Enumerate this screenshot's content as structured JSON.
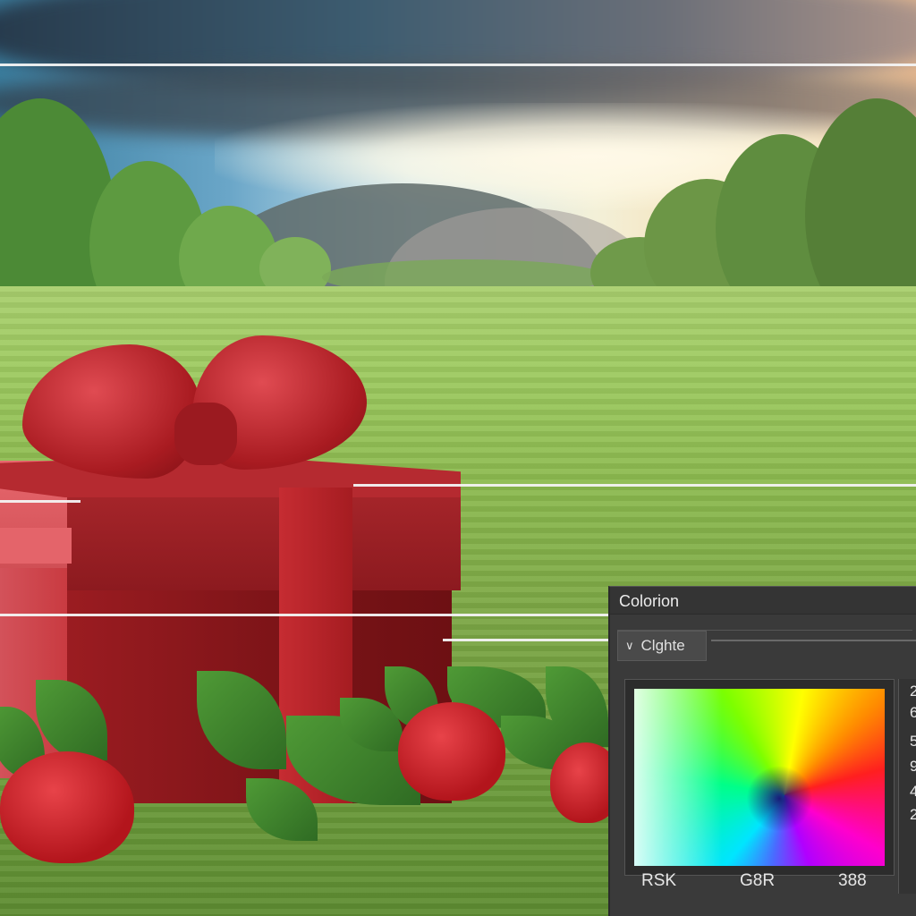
{
  "panel": {
    "title": "Colorion",
    "section_label": "Clghte",
    "section_icon": "chevron-down-icon",
    "axis_labels": [
      "RSK",
      "G8R",
      "388"
    ],
    "side_values": [
      "2",
      "6",
      "5",
      "9",
      "4",
      "2"
    ]
  },
  "colors": {
    "panel_bg": "#3a3a3a",
    "gift_red": "#a8262b",
    "grass": "#8dbb50"
  }
}
